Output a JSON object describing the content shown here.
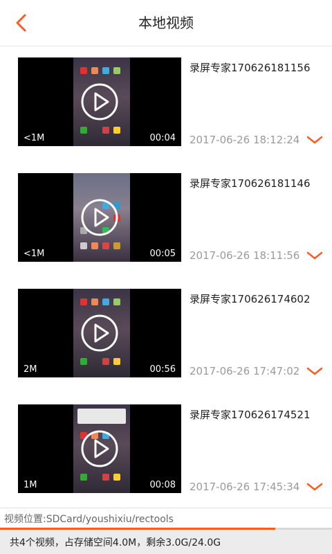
{
  "header": {
    "title": "本地视频"
  },
  "videos": [
    {
      "name": "录屏专家170626181156",
      "datetime": "2017-06-26 18:12:24",
      "size": "<1M",
      "duration": "00:04"
    },
    {
      "name": "录屏专家170626181146",
      "datetime": "2017-06-26 18:11:56",
      "size": "<1M",
      "duration": "00:05"
    },
    {
      "name": "录屏专家170626174602",
      "datetime": "2017-06-26 17:47:02",
      "size": "2M",
      "duration": "00:56"
    },
    {
      "name": "录屏专家170626174521",
      "datetime": "2017-06-26 17:45:34",
      "size": "1M",
      "duration": "00:08"
    }
  ],
  "footer": {
    "location": "视频位置:SDCard/youshixiu/rectools",
    "storage": "共4个视频，占存储空间4.0M，剩余3.0G/24.0G",
    "storage_used_fraction": 0.83
  },
  "colors": {
    "accent": "#ff5a22"
  }
}
